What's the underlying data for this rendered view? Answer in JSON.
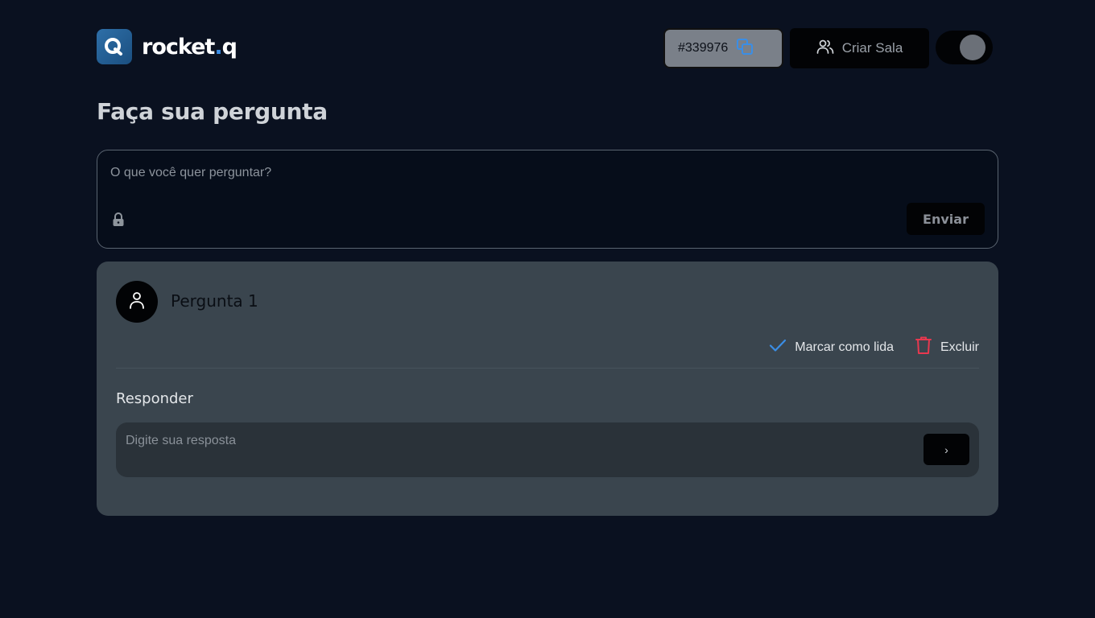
{
  "header": {
    "logo_text": "rocket",
    "logo_dot": ".",
    "logo_suffix": "q",
    "room_code": "#339976",
    "create_room_label": "Criar Sala"
  },
  "main": {
    "title": "Faça sua pergunta",
    "ask": {
      "placeholder": "O que você quer perguntar?",
      "send_label": "Enviar"
    },
    "questions": [
      {
        "text": "Pergunta 1",
        "mark_read_label": "Marcar como lida",
        "delete_label": "Excluir",
        "reply_label": "Responder",
        "reply_placeholder": "Digite sua resposta",
        "reply_send_label": "›"
      }
    ]
  },
  "colors": {
    "background": "#0a1120",
    "card": "#3a454e",
    "accent": "#3a8ee6",
    "danger": "#e8384f"
  },
  "icons": {
    "copy": "copy-icon",
    "users": "users-icon",
    "lock": "lock-icon",
    "user": "user-icon",
    "check": "check-icon",
    "trash": "trash-icon"
  }
}
